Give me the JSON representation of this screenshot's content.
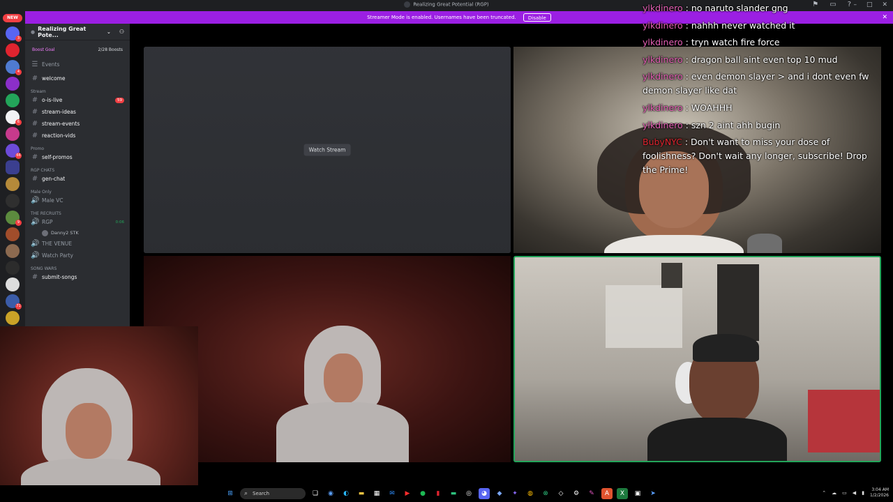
{
  "window": {
    "title": "Realizing Great Potential (RGP)"
  },
  "banner": {
    "text": "Streamer Mode is enabled. Usernames have been truncated.",
    "disable_label": "Disable"
  },
  "rail": {
    "new_label": "NEW"
  },
  "sidebar": {
    "server_name": "Realizing Great Pote...",
    "boost_goal": "Boost Goal",
    "boost_count": "2/28 Boosts",
    "events": "Events",
    "channels": [
      {
        "type": "text",
        "label": "welcome"
      },
      {
        "type": "category",
        "label": "Stream"
      },
      {
        "type": "text",
        "label": "o-is-live",
        "pill": "59"
      },
      {
        "type": "text",
        "label": "stream-ideas"
      },
      {
        "type": "text",
        "label": "stream-events"
      },
      {
        "type": "text",
        "label": "reaction-vids"
      },
      {
        "type": "category",
        "label": "Promo"
      },
      {
        "type": "text",
        "label": "self-promos"
      },
      {
        "type": "category",
        "label": "RGP CHATS"
      },
      {
        "type": "text",
        "label": "gen-chat"
      },
      {
        "type": "category",
        "label": "Male Only"
      },
      {
        "type": "voice",
        "label": "Male VC"
      },
      {
        "type": "category",
        "label": "THE RECRUITS"
      },
      {
        "type": "voice",
        "label": "RGP",
        "time": "0:06"
      },
      {
        "type": "user",
        "label": "Danny2 STK"
      },
      {
        "type": "voice",
        "label": "THE VENUE"
      },
      {
        "type": "voice",
        "label": "Watch Party"
      },
      {
        "type": "category",
        "label": "SONG WARS"
      },
      {
        "type": "text",
        "label": "submit-songs"
      }
    ]
  },
  "stream": {
    "watch_label": "Watch Stream"
  },
  "chat": {
    "messages": [
      {
        "user": "ylkdinero",
        "text": " : no naruto slander gng"
      },
      {
        "user": "ylkdinero",
        "text": " : nahhh never watched it"
      },
      {
        "user": "ylkdinero",
        "text": " : tryn watch fire force"
      },
      {
        "user": "ylkdinero",
        "text": " : dragon ball aint even top 10 mud"
      },
      {
        "user": "ylkdinero",
        "text": " : even demon slayer > and i dont even fw demon slayer like dat"
      },
      {
        "user": "ylkdinero",
        "text": " : WOAHHH"
      },
      {
        "user": "ylkdinero",
        "text": " : szn 2 aint ahh bugin"
      },
      {
        "user": "BubyNYC",
        "text": " : Don't want to miss your dose of foolishness? Don't wait any longer, subscribe! Drop the Prime!",
        "system": true
      }
    ]
  },
  "taskbar": {
    "search_label": "Search",
    "time": "3:04 AM",
    "date": "1/2/2026"
  },
  "colors": {
    "banner": "#9b1fe3",
    "chat_user": "#e45fb4",
    "speaking_border": "#23a55a"
  }
}
